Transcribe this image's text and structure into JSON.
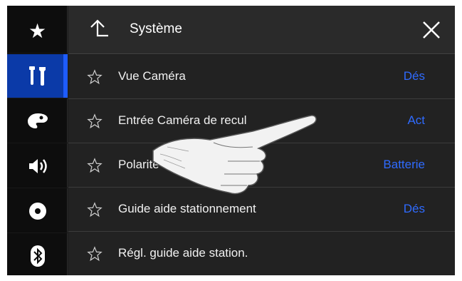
{
  "sidebar": {
    "items": [
      {
        "icon": "star-icon",
        "glyph": "★"
      },
      {
        "icon": "tools-icon",
        "glyph": "",
        "active": true
      },
      {
        "icon": "palette-icon",
        "glyph": ""
      },
      {
        "icon": "speaker-icon",
        "glyph": ""
      },
      {
        "icon": "disc-icon",
        "glyph": ""
      },
      {
        "icon": "bluetooth-icon",
        "glyph": ""
      }
    ]
  },
  "header": {
    "title": "Système",
    "back_icon": "back-arrow-icon",
    "close_icon": "close-icon"
  },
  "list": {
    "rows": [
      {
        "label": "Vue Caméra",
        "value": "Dés"
      },
      {
        "label": "Entrée Caméra de recul",
        "value": "Act"
      },
      {
        "label": "Polarité Caméra",
        "value": "Batterie"
      },
      {
        "label": "Guide aide stationnement",
        "value": "Dés"
      },
      {
        "label": "Régl. guide aide station.",
        "value": ""
      }
    ]
  },
  "colors": {
    "accent": "#2f6bff",
    "active_bg": "#0b3aa8",
    "rail_bg": "#0d0d0d",
    "header_bg": "#2a2a2a",
    "row_bg": "#222222"
  }
}
